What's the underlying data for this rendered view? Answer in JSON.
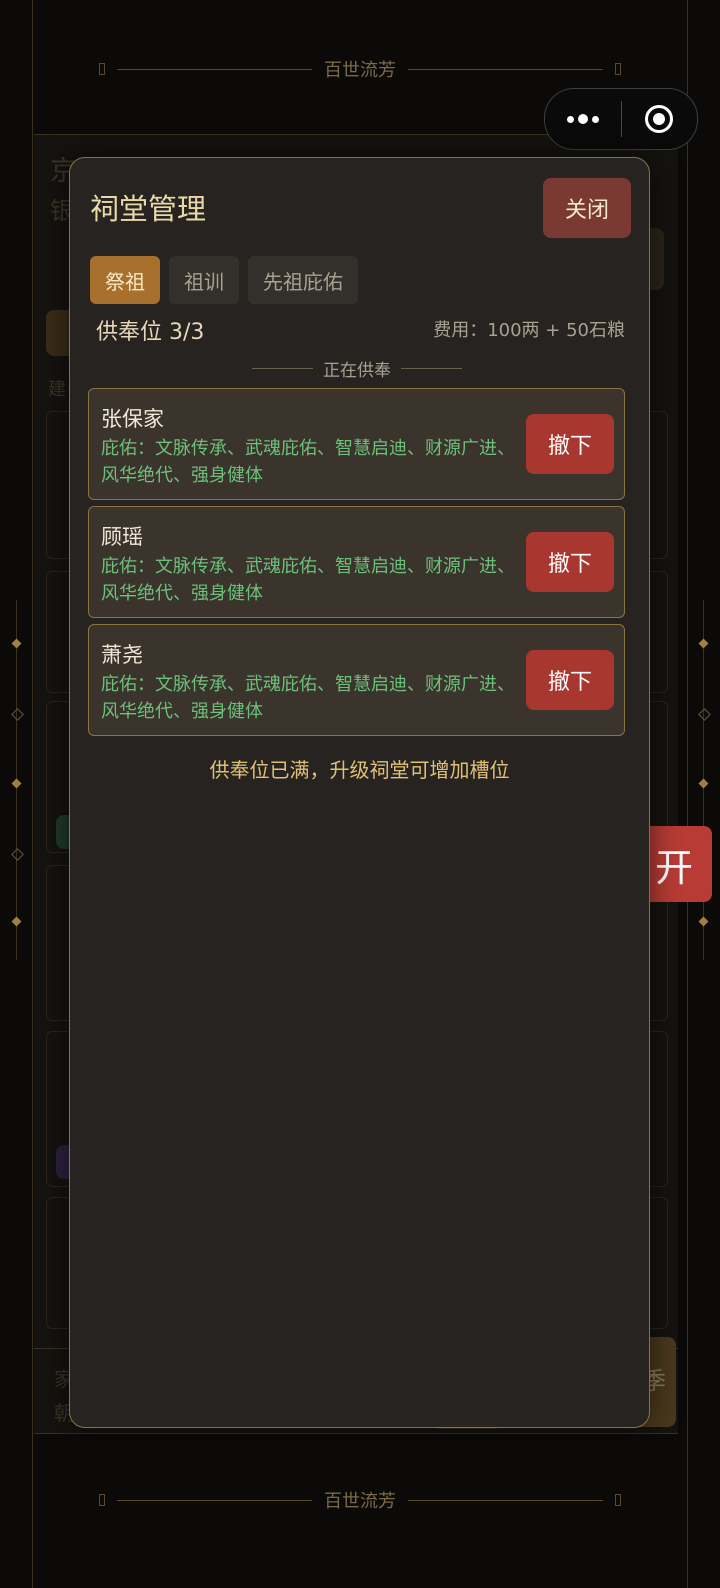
{
  "app": {
    "banner_top": "百世流芳",
    "banner_bottom": "百世流芳",
    "open_button": "开"
  },
  "background": {
    "family_title": "京兆张氏",
    "silver_label": "银",
    "build_label": "建",
    "bottom_left_label": "家",
    "bottom_left_label2": "朝",
    "season_label": "季"
  },
  "modal": {
    "title": "祠堂管理",
    "close_label": "关闭",
    "tabs": [
      {
        "label": "祭祖",
        "active": true
      },
      {
        "label": "祖训",
        "active": false
      },
      {
        "label": "先祖庇佑",
        "active": false
      }
    ],
    "slots_label": "供奉位 3/3",
    "cost_label": "费用：100两 + 50石粮",
    "section_label": "正在供奉",
    "ancestors": [
      {
        "name": "张保家",
        "blessing": "庇佑：文脉传承、武魂庇佑、智慧启迪、财源广进、风华绝代、强身健体",
        "action": "撤下"
      },
      {
        "name": "顾瑶",
        "blessing": "庇佑：文脉传承、武魂庇佑、智慧启迪、财源广进、风华绝代、强身健体",
        "action": "撤下"
      },
      {
        "name": "萧尧",
        "blessing": "庇佑：文脉传承、武魂庇佑、智慧启迪、财源广进、风华绝代、强身健体",
        "action": "撤下"
      }
    ],
    "full_note": "供奉位已满，升级祠堂可增加槽位"
  },
  "colors": {
    "accent_gold": "#8a7440",
    "tab_active": "#a7702c",
    "remove_red": "#a8372f",
    "blessing_green": "#6cc07a"
  }
}
